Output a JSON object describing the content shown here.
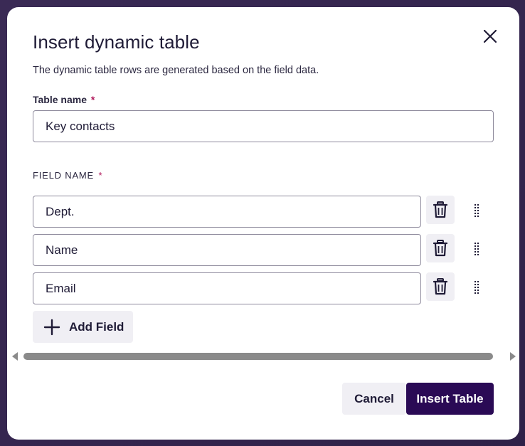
{
  "dialog": {
    "title": "Insert dynamic table",
    "subtitle": "The dynamic table rows are generated based on the field data.",
    "close_icon": "close-icon"
  },
  "table_name": {
    "label": "Table name",
    "required_mark": "*",
    "value": "Key contacts"
  },
  "fields": {
    "label": "FIELD NAME",
    "required_mark": "*",
    "items": [
      {
        "value": "Dept.",
        "delete_icon": "trash-icon",
        "drag_icon": "drag-handle-icon"
      },
      {
        "value": "Name",
        "delete_icon": "trash-icon",
        "drag_icon": "drag-handle-icon"
      },
      {
        "value": "Email",
        "delete_icon": "trash-icon",
        "drag_icon": "drag-handle-icon"
      }
    ],
    "add_label": "Add Field",
    "add_icon": "plus-icon"
  },
  "actions": {
    "cancel_label": "Cancel",
    "insert_label": "Insert Table"
  },
  "colors": {
    "primary": "#2a0a55",
    "required": "#b0175a",
    "secondary_button": "#f0eff4"
  }
}
